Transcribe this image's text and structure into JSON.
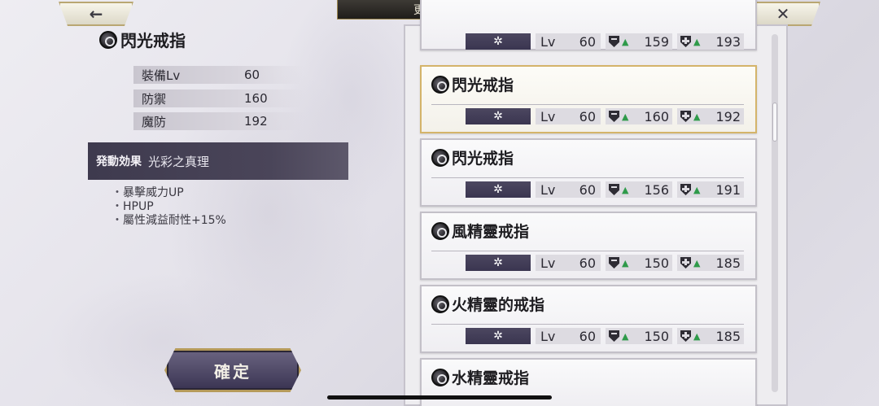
{
  "header": {
    "title": "更換裝備",
    "back_icon": "←",
    "close_icon": "✕"
  },
  "detail": {
    "name": "閃光戒指",
    "stats": [
      {
        "label": "裝備Lv",
        "value": "60"
      },
      {
        "label": "防禦",
        "value": "160"
      },
      {
        "label": "魔防",
        "value": "192"
      }
    ],
    "effect_label": "発動効果",
    "effect_name": "光彩之真理",
    "effects": [
      "暴擊威力UP",
      "HPUP",
      "屬性減益耐性+15%"
    ],
    "confirm_label": "確定"
  },
  "list": {
    "items": [
      {
        "name": "",
        "element": "✲",
        "lv_label": "Lv",
        "lv": "60",
        "def": "159",
        "mdef": "193",
        "selected": false
      },
      {
        "name": "閃光戒指",
        "element": "✲",
        "lv_label": "Lv",
        "lv": "60",
        "def": "160",
        "mdef": "192",
        "selected": true
      },
      {
        "name": "閃光戒指",
        "element": "✲",
        "lv_label": "Lv",
        "lv": "60",
        "def": "156",
        "mdef": "191",
        "selected": false
      },
      {
        "name": "風精靈戒指",
        "element": "✲",
        "lv_label": "Lv",
        "lv": "60",
        "def": "150",
        "mdef": "185",
        "selected": false
      },
      {
        "name": "火精靈的戒指",
        "element": "✲",
        "lv_label": "Lv",
        "lv": "60",
        "def": "150",
        "mdef": "185",
        "selected": false
      },
      {
        "name": "水精靈戒指",
        "element": "",
        "lv_label": "",
        "lv": "",
        "def": "",
        "mdef": "",
        "selected": false
      }
    ]
  },
  "colors": {
    "accent_gold": "#d4b46a",
    "panel_dark": "#3e3a4e",
    "up_arrow": "#2f9a4a"
  }
}
